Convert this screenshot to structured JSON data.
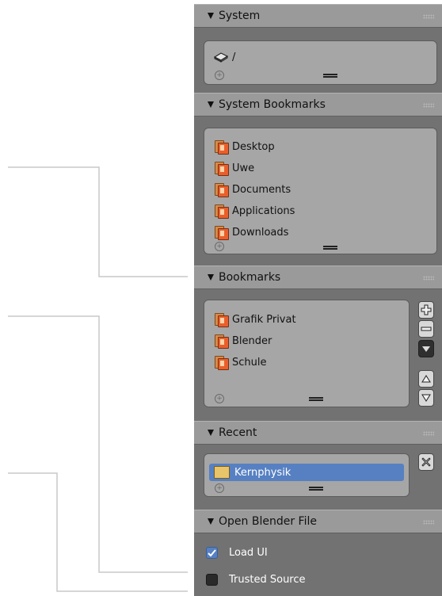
{
  "sections": {
    "system": {
      "title": "System",
      "items": [
        {
          "label": "/"
        }
      ]
    },
    "system_bookmarks": {
      "title": "System Bookmarks",
      "items": [
        {
          "label": "Desktop"
        },
        {
          "label": "Uwe"
        },
        {
          "label": "Documents"
        },
        {
          "label": "Applications"
        },
        {
          "label": "Downloads"
        }
      ]
    },
    "bookmarks": {
      "title": "Bookmarks",
      "items": [
        {
          "label": "Grafik Privat"
        },
        {
          "label": "Blender"
        },
        {
          "label": "Schule"
        }
      ]
    },
    "recent": {
      "title": "Recent",
      "items": [
        {
          "label": "Kernphysik",
          "selected": true
        }
      ]
    },
    "open_blender_file": {
      "title": "Open Blender File",
      "options": [
        {
          "label": "Load UI",
          "checked": true
        },
        {
          "label": "Trusted Source",
          "checked": false
        }
      ]
    }
  },
  "icons": {
    "plus": "+",
    "minus": "−",
    "close": "✕"
  },
  "colors": {
    "panel_bg": "#727272",
    "header_bg": "#9a9a9a",
    "list_bg": "#a6a6a6",
    "selection": "#5680c2",
    "folder_orange": "#e85f2b"
  }
}
